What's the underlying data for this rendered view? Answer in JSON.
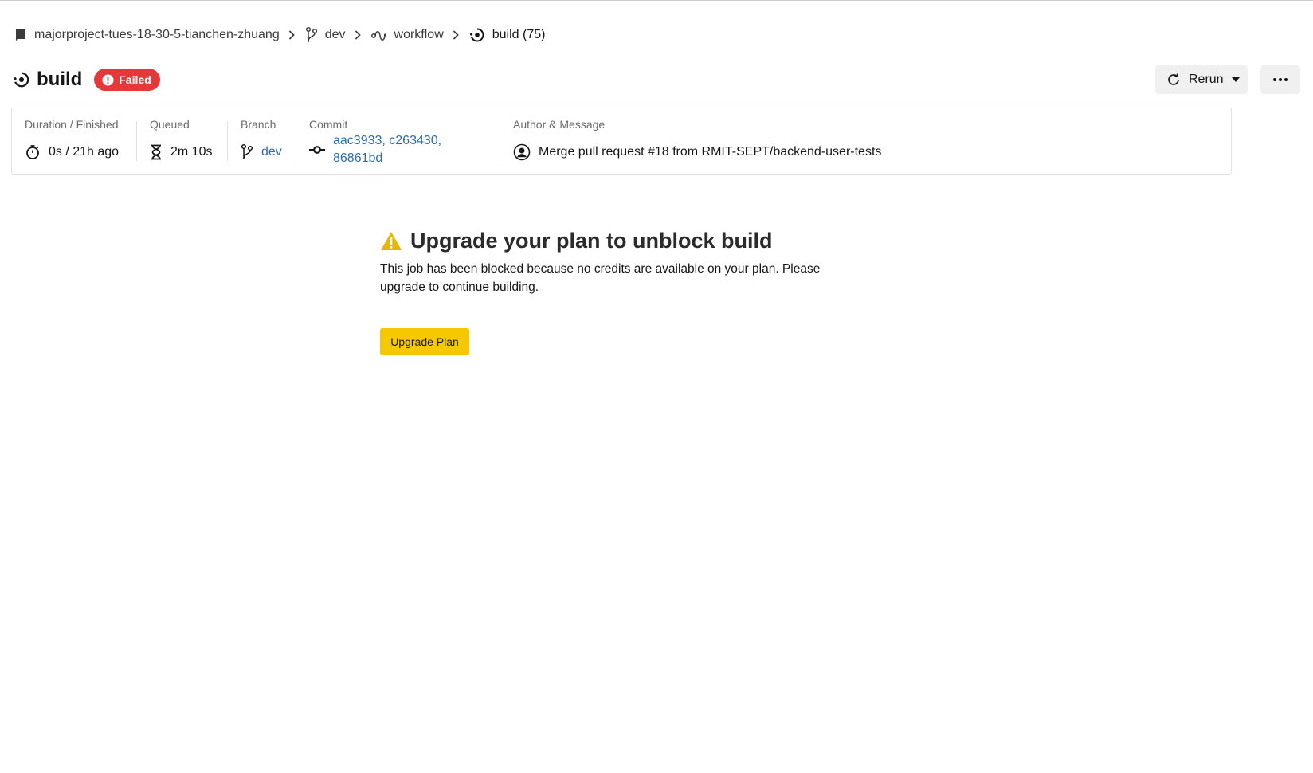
{
  "breadcrumb": {
    "project": "majorproject-tues-18-30-5-tianchen-zhuang",
    "branch": "dev",
    "workflow": "workflow",
    "job": "build (75)"
  },
  "header": {
    "title": "build",
    "status": "Failed",
    "rerun_label": "Rerun",
    "more_label": "•••"
  },
  "info": {
    "duration": {
      "label": "Duration / Finished",
      "value": "0s / 21h ago"
    },
    "queued": {
      "label": "Queued",
      "value": "2m 10s"
    },
    "branch": {
      "label": "Branch",
      "value": "dev"
    },
    "commit": {
      "label": "Commit",
      "value": "aac3933, c263430, 86861bd"
    },
    "author": {
      "label": "Author & Message",
      "value": "Merge pull request #18 from RMIT-SEPT/backend-user-tests"
    }
  },
  "blocked": {
    "heading": "Upgrade your plan to unblock build",
    "message": "This job has been blocked because no credits are available on your plan. Please upgrade to continue building.",
    "button": "Upgrade Plan"
  },
  "colors": {
    "status_failed": "#e5383b",
    "link": "#2a6db3",
    "upgrade_button": "#f5c800",
    "warning": "#e8b800"
  }
}
